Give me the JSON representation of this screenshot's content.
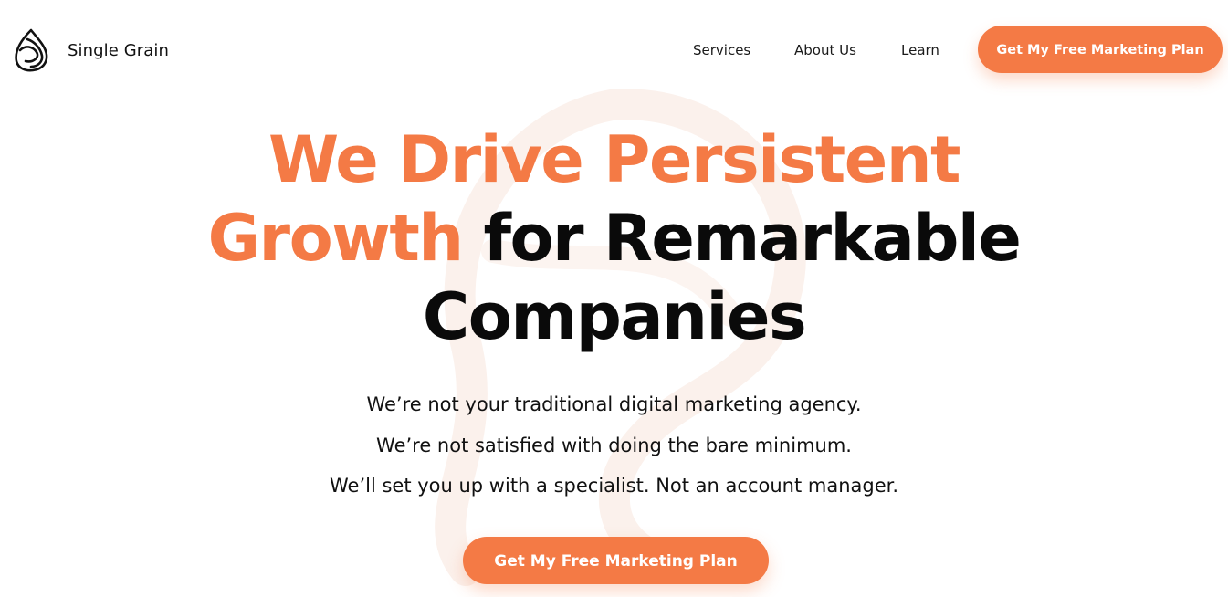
{
  "brand": {
    "name": "Single Grain",
    "logo_icon": "drop-swirl-logo-icon",
    "accent_color": "#f47a45",
    "text_color": "#0a0a0a"
  },
  "nav": {
    "items": [
      {
        "label": "Services"
      },
      {
        "label": "About Us"
      },
      {
        "label": "Learn"
      }
    ],
    "cta_label": "Get My Free Marketing Plan"
  },
  "hero": {
    "title_orange_1": "We Drive Persistent",
    "title_orange_2": "Growth",
    "title_dark_2": "for Remarkable",
    "title_dark_3": "Companies",
    "subtitle_lines": [
      "We’re not your traditional digital marketing agency.",
      "We’re not satisfied with doing the bare minimum.",
      "We’ll set you up with a specialist. Not an account manager."
    ],
    "cta_label": "Get My Free Marketing Plan"
  }
}
